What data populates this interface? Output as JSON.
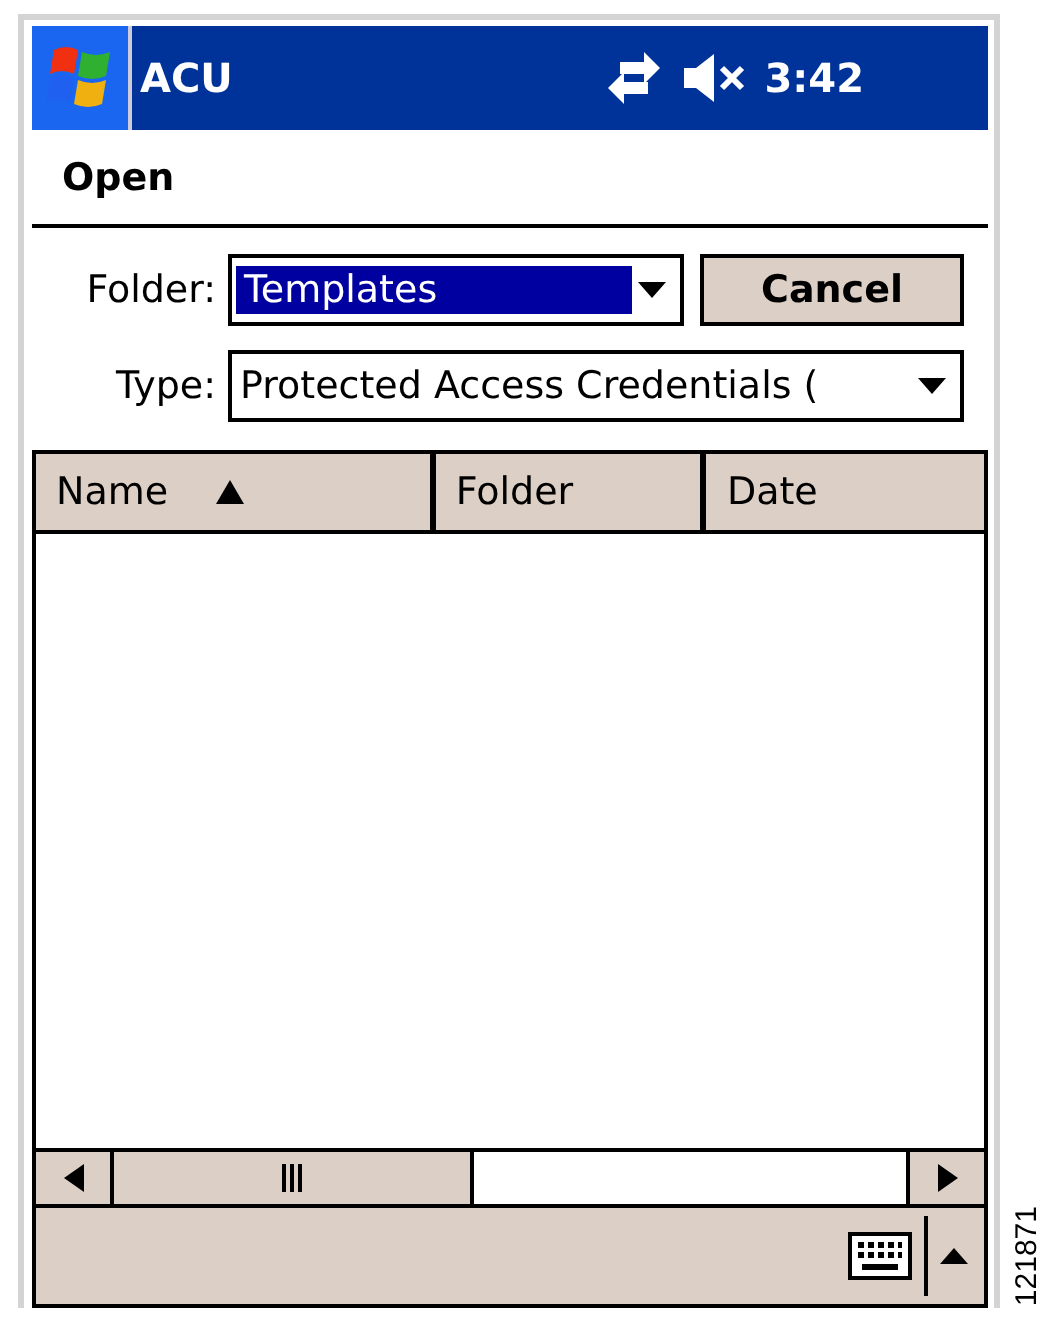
{
  "title_bar": {
    "title": "ACU",
    "time": "3:42"
  },
  "menu": {
    "label": "Open"
  },
  "folder": {
    "label": "Folder:",
    "value": "Templates",
    "highlighted": true
  },
  "cancel_button": {
    "label": "Cancel"
  },
  "type": {
    "label": "Type:",
    "value": "Protected Access Credentials ("
  },
  "table": {
    "columns": [
      {
        "label": "Name",
        "sorted": true
      },
      {
        "label": "Folder",
        "sorted": false
      },
      {
        "label": "Date",
        "sorted": false
      }
    ]
  },
  "figure_number": "121871"
}
